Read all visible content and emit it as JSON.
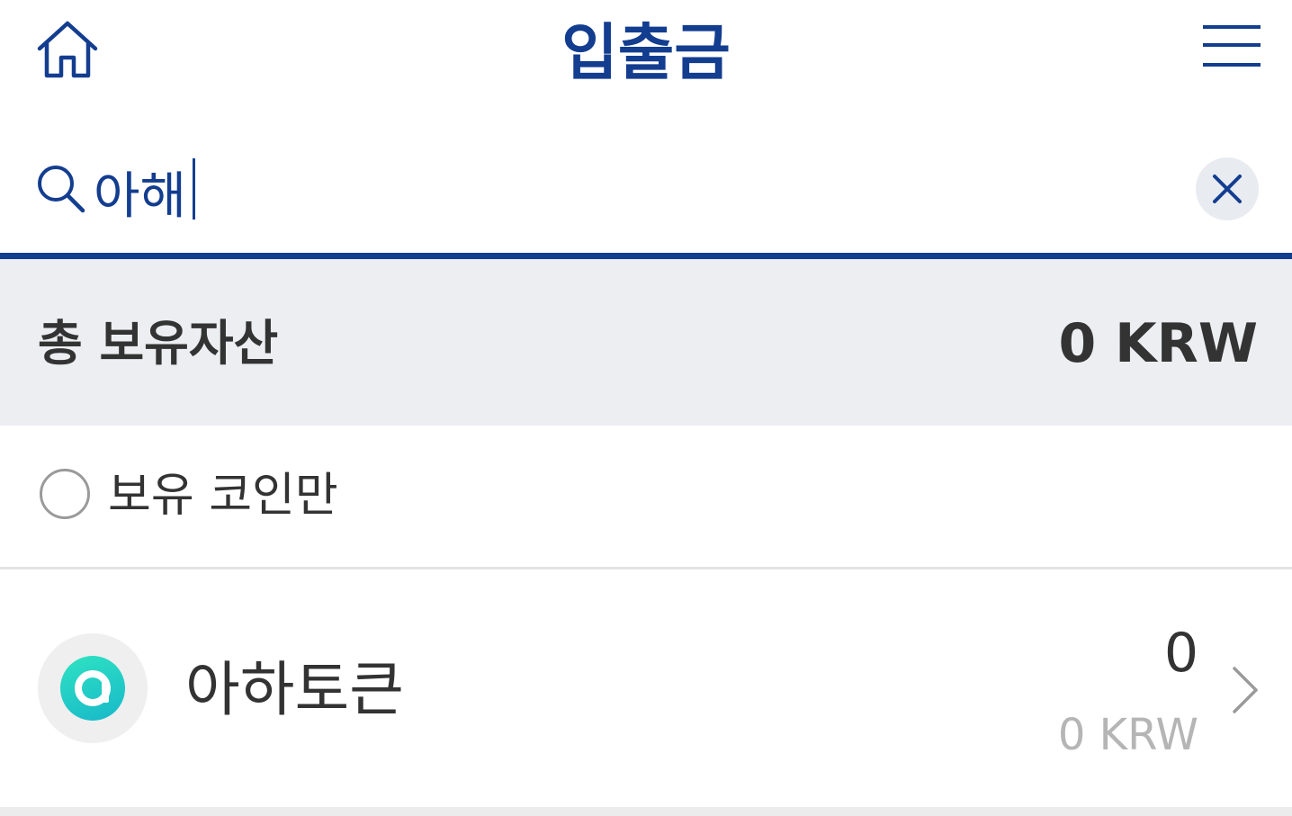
{
  "header": {
    "title": "입출금",
    "home_icon": "home-icon",
    "menu_icon": "hamburger-menu-icon"
  },
  "search": {
    "value": "아해",
    "placeholder": "",
    "search_icon": "search-icon",
    "clear_icon": "close-icon"
  },
  "summary": {
    "label": "총 보유자산",
    "value": "0 KRW"
  },
  "filter": {
    "label": "보유 코인만",
    "checked": false
  },
  "coins": [
    {
      "name": "아하토큰",
      "quantity": "0",
      "krw_value": "0 KRW",
      "logo_icon": "aha-token-logo-icon",
      "chevron_icon": "chevron-right-icon"
    }
  ],
  "colors": {
    "brand": "#133d8f",
    "summary_bg": "#eceef2",
    "text": "#333333",
    "muted": "#b5b5b5",
    "coin_logo": "#1fcfc5"
  }
}
